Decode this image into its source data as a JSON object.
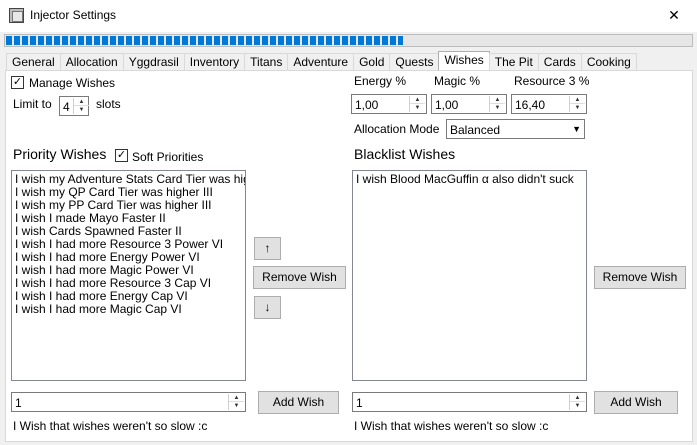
{
  "window": {
    "title": "Injector Settings",
    "close_glyph": "✕",
    "progress_fraction": 0.58
  },
  "tabs": [
    {
      "label": "General"
    },
    {
      "label": "Allocation"
    },
    {
      "label": "Yggdrasil"
    },
    {
      "label": "Inventory"
    },
    {
      "label": "Titans"
    },
    {
      "label": "Adventure"
    },
    {
      "label": "Gold"
    },
    {
      "label": "Quests"
    },
    {
      "label": "Wishes",
      "active": true
    },
    {
      "label": "The Pit"
    },
    {
      "label": "Cards"
    },
    {
      "label": "Cooking"
    }
  ],
  "manage": {
    "label": "Manage Wishes",
    "checked": true
  },
  "limit": {
    "label": "Limit to",
    "value": "4",
    "suffix": "slots"
  },
  "ratios": {
    "energy": {
      "label": "Energy %",
      "value": "1,00"
    },
    "magic": {
      "label": "Magic %",
      "value": "1,00"
    },
    "resource": {
      "label": "Resource 3 %",
      "value": "16,40"
    }
  },
  "allocation": {
    "label": "Allocation Mode",
    "selected": "Balanced"
  },
  "priority": {
    "heading": "Priority Wishes",
    "soft_label": "Soft Priorities",
    "soft_checked": true,
    "items": [
      "I wish my Adventure Stats Card Tier was higher",
      "I wish my QP Card Tier was higher III",
      "I wish my PP Card Tier was higher III",
      "I wish I made Mayo Faster II",
      "I wish Cards Spawned Faster II",
      "I wish I had more Resource 3 Power VI",
      "I wish I had more Energy Power VI",
      "I wish I had more Magic Power VI",
      "I wish I had more Resource 3 Cap VI",
      "I wish I had more Energy Cap VI",
      "I wish I had more Magic Cap VI"
    ],
    "input_value": "1",
    "add_label": "Add Wish",
    "status": "I Wish that wishes weren't so slow :c"
  },
  "middle": {
    "up_glyph": "↑",
    "down_glyph": "↓",
    "remove_label": "Remove Wish"
  },
  "blacklist": {
    "heading": "Blacklist Wishes",
    "items": [
      "I wish Blood MacGuffin α also didn't suck"
    ],
    "remove_label": "Remove Wish",
    "input_value": "1",
    "add_label": "Add Wish",
    "status": "I Wish that wishes weren't so slow :c"
  }
}
